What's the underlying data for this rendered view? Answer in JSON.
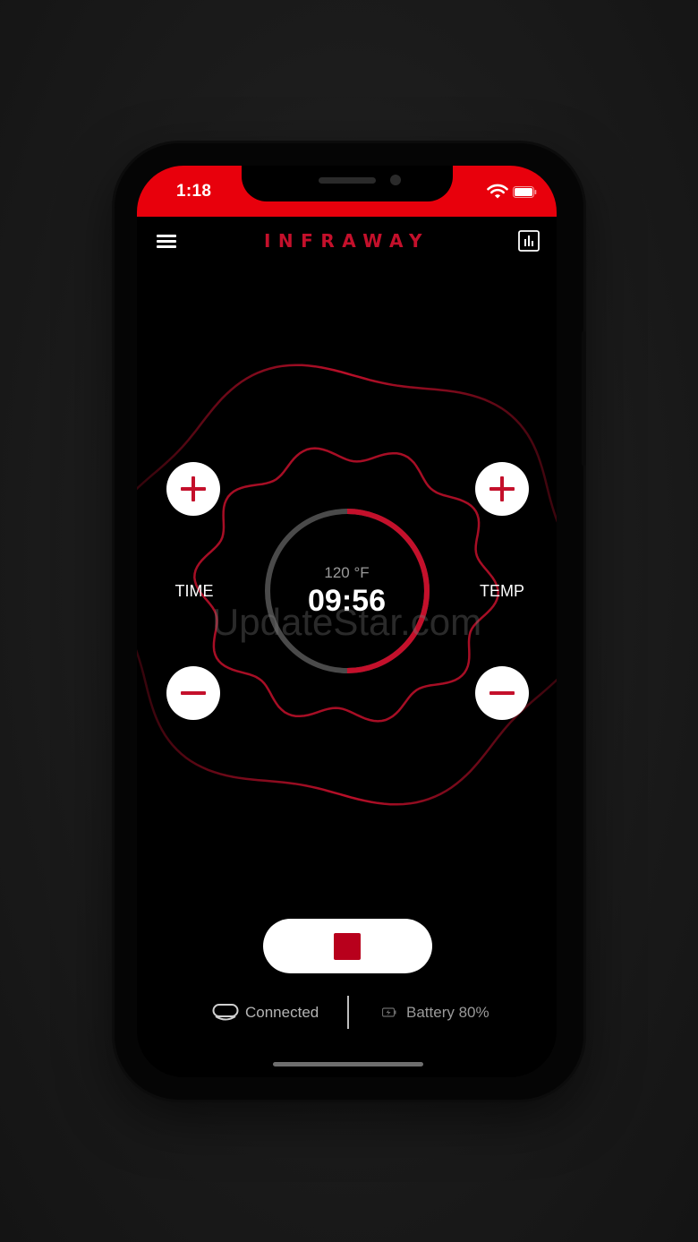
{
  "status_bar": {
    "time": "1:18",
    "icons": [
      "wifi-icon",
      "battery-icon"
    ],
    "color": "#e8000c"
  },
  "header": {
    "menu_icon": "hamburger-menu-icon",
    "brand": "INFRAWAY",
    "stats_icon": "bar-chart-icon"
  },
  "controls": {
    "time_label": "TIME",
    "temp_label": "TEMP",
    "setpoint": "120 °F",
    "timer": "09:56",
    "progress_fraction": 0.5,
    "increase_icon": "plus-icon",
    "decrease_icon": "minus-icon"
  },
  "watermark": "UpdateStar.com",
  "footer": {
    "stop_icon": "stop-icon",
    "connection_status": "Connected",
    "battery_status": "Battery 80%"
  },
  "colors": {
    "accent": "#c4102b",
    "status_red": "#e8000c",
    "background": "#000000"
  }
}
